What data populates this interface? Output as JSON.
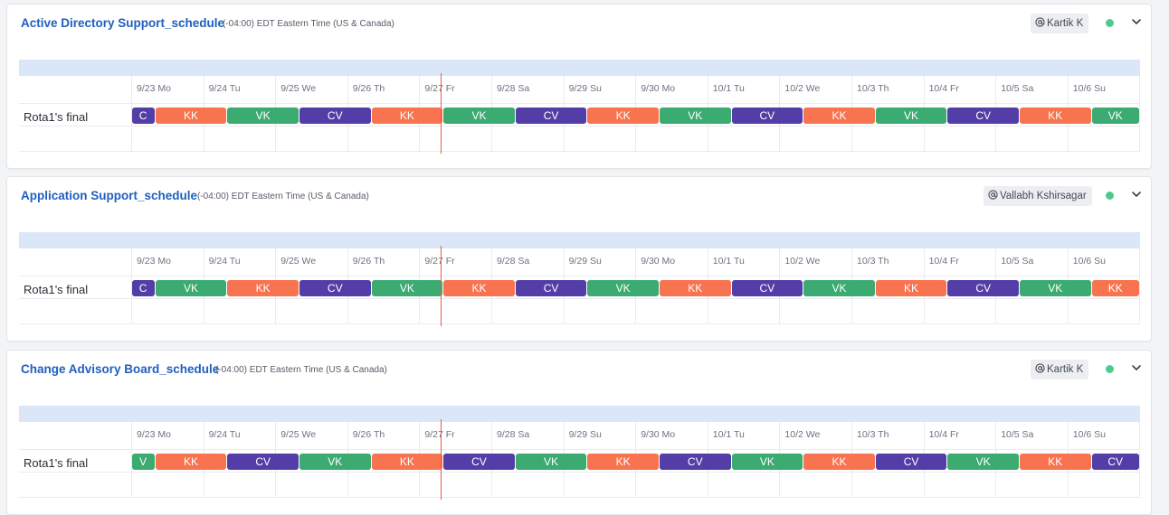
{
  "colors": {
    "VK": "#3bab72",
    "KK": "#f8734f",
    "CV": "#533ea8",
    "V": "#3bab72",
    "C": "#533ea8",
    "now_line": "#ef5a48",
    "status_active": "#4ecb8c"
  },
  "dates": [
    "9/23 Mo",
    "9/24 Tu",
    "9/25 We",
    "9/26 Th",
    "9/27 Fr",
    "9/28 Sa",
    "9/29 Su",
    "9/30 Mo",
    "10/1 Tu",
    "10/2 We",
    "10/3 Th",
    "10/4 Fr",
    "10/5 Sa",
    "10/6 Su"
  ],
  "now_fraction": 4.3,
  "schedules": [
    {
      "title": "Active Directory Support_schedule",
      "timezone": "(-04:00) EDT Eastern Time (US & Canada)",
      "owner": "Kartik K",
      "owner_icon": "at-sign-icon",
      "status": "active",
      "row_label": "Rota1's final",
      "shifts": [
        {
          "label": "C",
          "who": "C",
          "start": 0,
          "end": 0.33
        },
        {
          "label": "KK",
          "who": "KK",
          "start": 0.33,
          "end": 1.33
        },
        {
          "label": "VK",
          "who": "VK",
          "start": 1.33,
          "end": 2.33
        },
        {
          "label": "CV",
          "who": "CV",
          "start": 2.33,
          "end": 3.33
        },
        {
          "label": "KK",
          "who": "KK",
          "start": 3.33,
          "end": 4.33
        },
        {
          "label": "VK",
          "who": "VK",
          "start": 4.33,
          "end": 5.33
        },
        {
          "label": "CV",
          "who": "CV",
          "start": 5.33,
          "end": 6.33
        },
        {
          "label": "KK",
          "who": "KK",
          "start": 6.33,
          "end": 7.33
        },
        {
          "label": "VK",
          "who": "VK",
          "start": 7.33,
          "end": 8.33
        },
        {
          "label": "CV",
          "who": "CV",
          "start": 8.33,
          "end": 9.33
        },
        {
          "label": "KK",
          "who": "KK",
          "start": 9.33,
          "end": 10.33
        },
        {
          "label": "VK",
          "who": "VK",
          "start": 10.33,
          "end": 11.33
        },
        {
          "label": "CV",
          "who": "CV",
          "start": 11.33,
          "end": 12.33
        },
        {
          "label": "KK",
          "who": "KK",
          "start": 12.33,
          "end": 13.33
        },
        {
          "label": "VK",
          "who": "VK",
          "start": 13.33,
          "end": 14
        }
      ]
    },
    {
      "title": "Application Support_schedule",
      "timezone": "(-04:00) EDT Eastern Time (US & Canada)",
      "owner": "Vallabh Kshirsagar",
      "owner_icon": "at-sign-icon",
      "status": "active",
      "row_label": "Rota1's final",
      "shifts": [
        {
          "label": "C",
          "who": "C",
          "start": 0,
          "end": 0.33
        },
        {
          "label": "VK",
          "who": "VK",
          "start": 0.33,
          "end": 1.33
        },
        {
          "label": "KK",
          "who": "KK",
          "start": 1.33,
          "end": 2.33
        },
        {
          "label": "CV",
          "who": "CV",
          "start": 2.33,
          "end": 3.33
        },
        {
          "label": "VK",
          "who": "VK",
          "start": 3.33,
          "end": 4.33
        },
        {
          "label": "KK",
          "who": "KK",
          "start": 4.33,
          "end": 5.33
        },
        {
          "label": "CV",
          "who": "CV",
          "start": 5.33,
          "end": 6.33
        },
        {
          "label": "VK",
          "who": "VK",
          "start": 6.33,
          "end": 7.33
        },
        {
          "label": "KK",
          "who": "KK",
          "start": 7.33,
          "end": 8.33
        },
        {
          "label": "CV",
          "who": "CV",
          "start": 8.33,
          "end": 9.33
        },
        {
          "label": "VK",
          "who": "VK",
          "start": 9.33,
          "end": 10.33
        },
        {
          "label": "KK",
          "who": "KK",
          "start": 10.33,
          "end": 11.33
        },
        {
          "label": "CV",
          "who": "CV",
          "start": 11.33,
          "end": 12.33
        },
        {
          "label": "VK",
          "who": "VK",
          "start": 12.33,
          "end": 13.33
        },
        {
          "label": "KK",
          "who": "KK",
          "start": 13.33,
          "end": 14
        }
      ]
    },
    {
      "title": "Change Advisory Board_schedule",
      "timezone": "(-04:00) EDT Eastern Time (US & Canada)",
      "owner": "Kartik K",
      "owner_icon": "at-sign-icon",
      "status": "active",
      "row_label": "Rota1's final",
      "shifts": [
        {
          "label": "V",
          "who": "V",
          "start": 0,
          "end": 0.33
        },
        {
          "label": "KK",
          "who": "KK",
          "start": 0.33,
          "end": 1.33
        },
        {
          "label": "CV",
          "who": "CV",
          "start": 1.33,
          "end": 2.33
        },
        {
          "label": "VK",
          "who": "VK",
          "start": 2.33,
          "end": 3.33
        },
        {
          "label": "KK",
          "who": "KK",
          "start": 3.33,
          "end": 4.33
        },
        {
          "label": "CV",
          "who": "CV",
          "start": 4.33,
          "end": 5.33
        },
        {
          "label": "VK",
          "who": "VK",
          "start": 5.33,
          "end": 6.33
        },
        {
          "label": "KK",
          "who": "KK",
          "start": 6.33,
          "end": 7.33
        },
        {
          "label": "CV",
          "who": "CV",
          "start": 7.33,
          "end": 8.33
        },
        {
          "label": "VK",
          "who": "VK",
          "start": 8.33,
          "end": 9.33
        },
        {
          "label": "KK",
          "who": "KK",
          "start": 9.33,
          "end": 10.33
        },
        {
          "label": "CV",
          "who": "CV",
          "start": 10.33,
          "end": 11.33
        },
        {
          "label": "VK",
          "who": "VK",
          "start": 11.33,
          "end": 12.33
        },
        {
          "label": "KK",
          "who": "KK",
          "start": 12.33,
          "end": 13.33
        },
        {
          "label": "CV",
          "who": "CV",
          "start": 13.33,
          "end": 14
        }
      ]
    }
  ]
}
